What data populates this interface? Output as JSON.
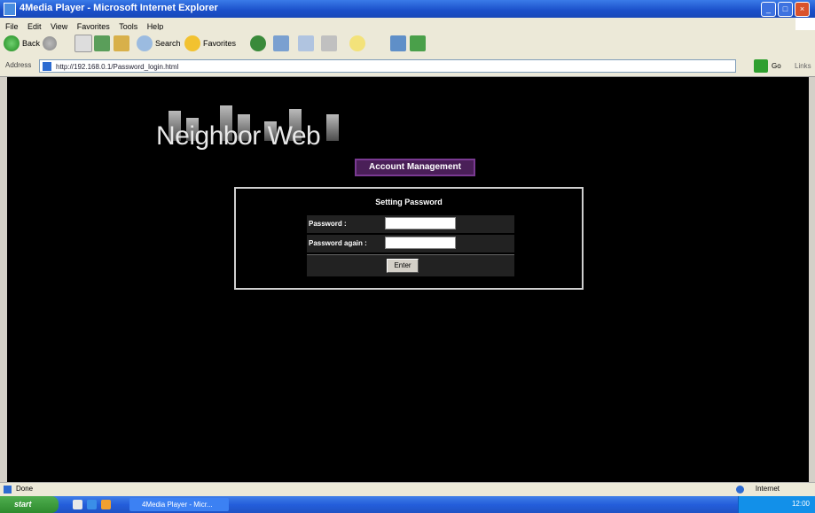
{
  "window": {
    "title": "4Media Player - Microsoft Internet Explorer",
    "controls": [
      "_",
      "□",
      "×"
    ]
  },
  "menubar": {
    "items": [
      "File",
      "Edit",
      "View",
      "Favorites",
      "Tools",
      "Help"
    ]
  },
  "toolbar": {
    "back_label": "Back",
    "search_label": "Search",
    "favorites_label": "Favorites"
  },
  "address": {
    "label": "Address",
    "url": "http://192.168.0.1/Password_login.html",
    "go_label": "Go",
    "links_label": "Links"
  },
  "page": {
    "logo_text": "Neighbor Web",
    "section_button": "Account Management",
    "panel_title": "Setting Password",
    "password_label": "Password :",
    "password_again_label": "Password again :",
    "password_value": "",
    "password_again_value": "",
    "enter_label": "Enter"
  },
  "statusbar": {
    "status": "Done",
    "zone": "Internet"
  },
  "taskbar": {
    "start_label": "start",
    "task_label": "4Media Player - Micr...",
    "clock": "12:00"
  }
}
